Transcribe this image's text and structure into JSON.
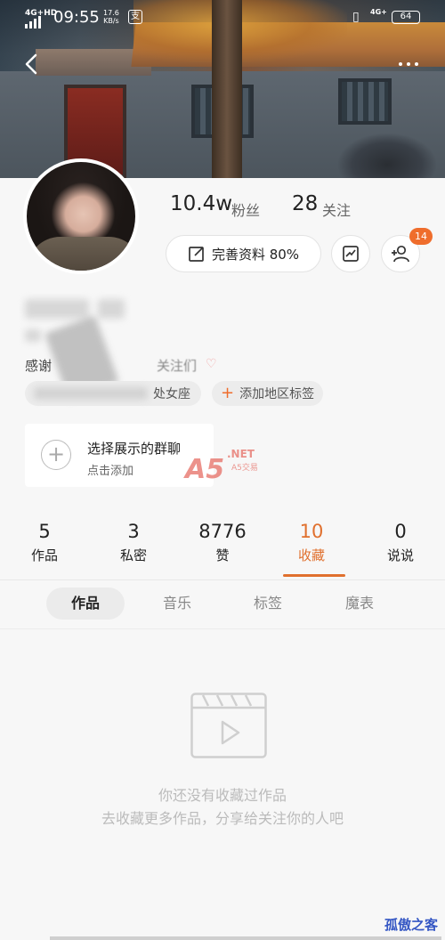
{
  "status_bar": {
    "network_left": "4G+HD",
    "time": "09:55",
    "speed_value": "17.6",
    "speed_unit": "KB/s",
    "app_icon_label": "支",
    "network_right": "4G+",
    "battery": "64"
  },
  "profile": {
    "fans_count": "10.4w",
    "fans_label": "粉丝",
    "following_count": "28",
    "following_label": "关注",
    "edit_button_label": "完善资料 80%",
    "friend_badge": "14",
    "bio_prefix": "感谢",
    "bio_suffix": "关注们",
    "tags": [
      {
        "label": "处女座"
      },
      {
        "label": "添加地区标签",
        "prefix": "+"
      }
    ]
  },
  "group_card": {
    "title": "选择展示的群聊",
    "subtitle": "点击添加"
  },
  "watermark": {
    "main": "A5",
    "net": ".NET",
    "cn": "A5交易",
    "corner": "孤傲之客"
  },
  "counters": [
    {
      "num": "5",
      "label": "作品"
    },
    {
      "num": "3",
      "label": "私密"
    },
    {
      "num": "8776",
      "label": "赞"
    },
    {
      "num": "10",
      "label": "收藏",
      "active": true
    },
    {
      "num": "0",
      "label": "说说"
    }
  ],
  "sub_tabs": [
    {
      "label": "作品",
      "active": true
    },
    {
      "label": "音乐"
    },
    {
      "label": "标签"
    },
    {
      "label": "魔表"
    }
  ],
  "empty_state": {
    "line1": "你还没有收藏过作品",
    "line2": "去收藏更多作品，分享给关注你的人吧"
  },
  "colors": {
    "accent": "#e0702e",
    "badge": "#ef6d2c"
  }
}
